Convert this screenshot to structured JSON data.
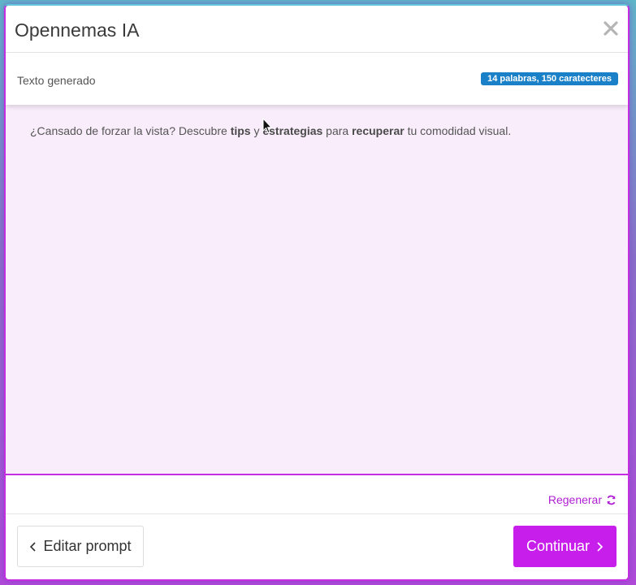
{
  "modal": {
    "title": "Opennemas IA",
    "close_label": "×"
  },
  "result": {
    "label": "Texto generado",
    "count_badge": "14 palabras, 150 caratecteres"
  },
  "generated": {
    "parts": [
      {
        "text": "¿Cansado de forzar la vista? Descubre ",
        "bold": false
      },
      {
        "text": "tips",
        "bold": true
      },
      {
        "text": " y ",
        "bold": false
      },
      {
        "text": "estrategias",
        "bold": true
      },
      {
        "text": " para ",
        "bold": false
      },
      {
        "text": "recuperar",
        "bold": true
      },
      {
        "text": " tu comodidad visual.",
        "bold": false
      }
    ]
  },
  "actions": {
    "regenerate_label": "Regenerar",
    "edit_prompt_label": "Editar prompt",
    "continue_label": "Continuar"
  },
  "colors": {
    "accent": "#c81eec",
    "badge": "#1a80c8",
    "generated_bg": "#f9ecfb"
  },
  "icons": {
    "close": "close-icon",
    "regenerate": "refresh-icon",
    "back": "chevron-left-icon",
    "forward": "chevron-right-icon",
    "cursor": "mouse-cursor-icon"
  }
}
